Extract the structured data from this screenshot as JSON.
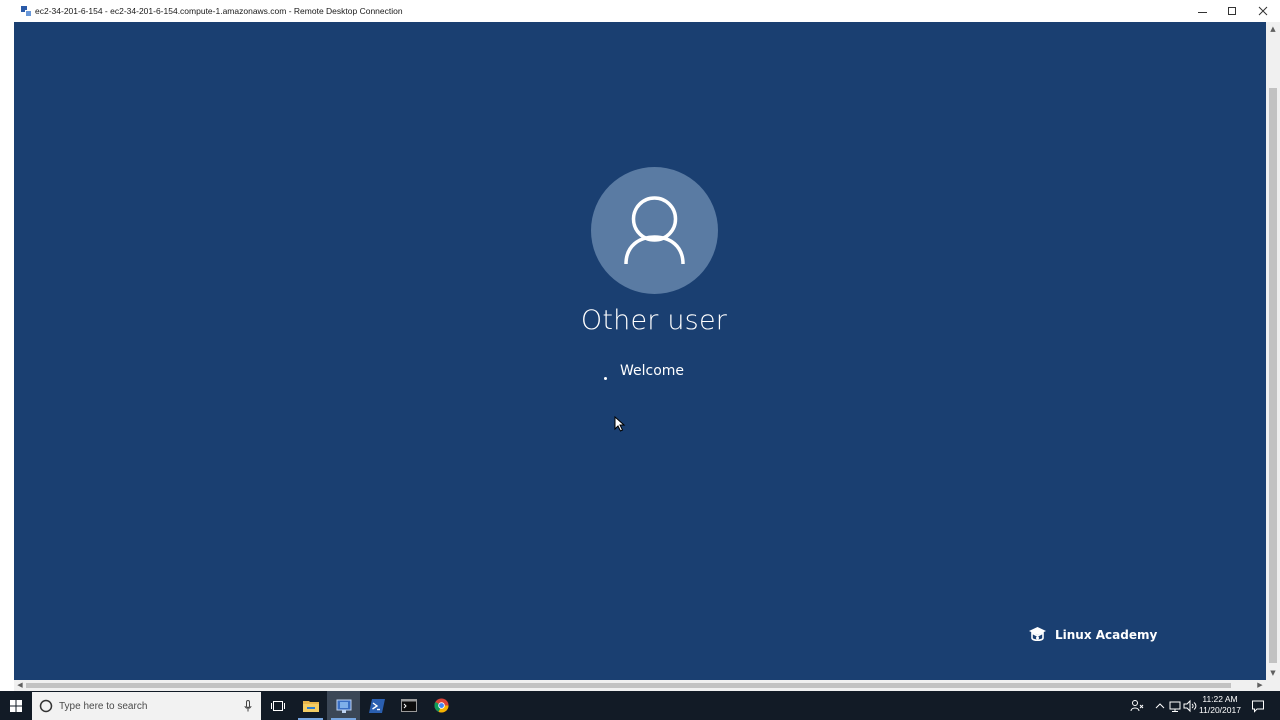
{
  "window": {
    "title": "ec2-34-201-6-154 - ec2-34-201-6-154.compute-1.amazonaws.com - Remote Desktop Connection"
  },
  "login": {
    "user_name": "Other user",
    "status": "Welcome",
    "avatar_icon": "user-silhouette-icon"
  },
  "brand": {
    "name": "Linux Academy",
    "icon": "graduation-cap-icon"
  },
  "taskbar": {
    "search_placeholder": "Type here to search",
    "apps": [
      "task-view",
      "file-explorer",
      "remote-desktop-connection",
      "powershell",
      "command-prompt",
      "chrome"
    ],
    "clock_time": "11:22 AM",
    "clock_date": "11/20/2017"
  },
  "colors": {
    "remote_background": "#1a3f71",
    "avatar": "#5a7ba3",
    "taskbar": "#121b26"
  }
}
